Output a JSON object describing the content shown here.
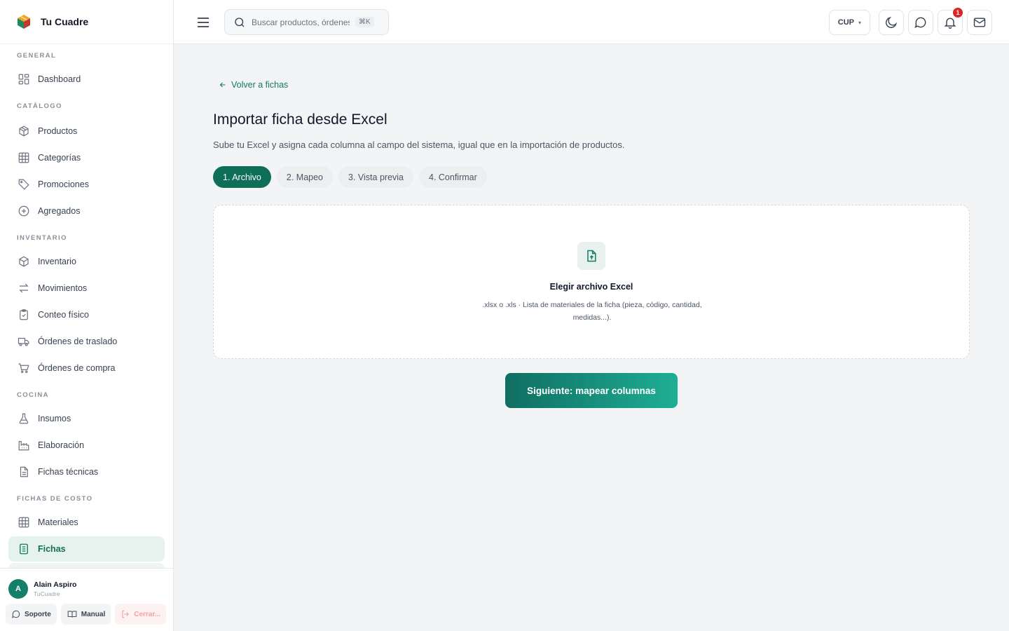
{
  "brand": {
    "name": "Tu Cuadre"
  },
  "sidebar": {
    "sections": [
      {
        "title": "GENERAL",
        "items": [
          {
            "label": "Dashboard",
            "icon": "dashboard-icon"
          }
        ]
      },
      {
        "title": "CATÁLOGO",
        "items": [
          {
            "label": "Productos",
            "icon": "box-icon"
          },
          {
            "label": "Categorías",
            "icon": "grid-icon"
          },
          {
            "label": "Promociones",
            "icon": "tag-icon"
          },
          {
            "label": "Agregados",
            "icon": "plus-circle-icon"
          }
        ]
      },
      {
        "title": "INVENTARIO",
        "items": [
          {
            "label": "Inventario",
            "icon": "box-icon"
          },
          {
            "label": "Movimientos",
            "icon": "arrows-icon"
          },
          {
            "label": "Conteo físico",
            "icon": "clipboard-check-icon"
          },
          {
            "label": "Órdenes de traslado",
            "icon": "truck-icon"
          },
          {
            "label": "Órdenes de compra",
            "icon": "cart-icon"
          }
        ]
      },
      {
        "title": "COCINA",
        "items": [
          {
            "label": "Insumos",
            "icon": "flask-icon"
          },
          {
            "label": "Elaboración",
            "icon": "factory-icon"
          },
          {
            "label": "Fichas técnicas",
            "icon": "document-icon"
          }
        ]
      },
      {
        "title": "FICHAS DE COSTO",
        "items": [
          {
            "label": "Materiales",
            "icon": "grid-icon"
          },
          {
            "label": "Fichas",
            "icon": "document-list-icon",
            "active": true
          }
        ]
      }
    ]
  },
  "user": {
    "initial": "A",
    "name": "Alain Aspiro",
    "org": "TuCuadre",
    "support_label": "Soporte",
    "manual_label": "Manual",
    "logout_label": "Cerrar..."
  },
  "topbar": {
    "search_placeholder": "Buscar productos, órdenes...",
    "shortcut": "⌘K",
    "currency": "CUP",
    "notification_count": "1"
  },
  "main": {
    "back_label": "Volver a fichas",
    "title": "Importar ficha desde Excel",
    "subtitle": "Sube tu Excel y asigna cada columna al campo del sistema, igual que en la importación de productos.",
    "steps": [
      {
        "label": "1. Archivo",
        "active": true
      },
      {
        "label": "2. Mapeo"
      },
      {
        "label": "3. Vista previa"
      },
      {
        "label": "4. Confirmar"
      }
    ],
    "dropzone": {
      "title": "Elegir archivo Excel",
      "hint": ".xlsx o .xls · Lista de materiales de la ficha (pieza, código, cantidad, medidas...)."
    },
    "next_label": "Siguiente: mapear columnas"
  },
  "colors": {
    "accent": "#0f6e58",
    "accent_light": "#e6f2ee",
    "badge": "#dc2626"
  }
}
